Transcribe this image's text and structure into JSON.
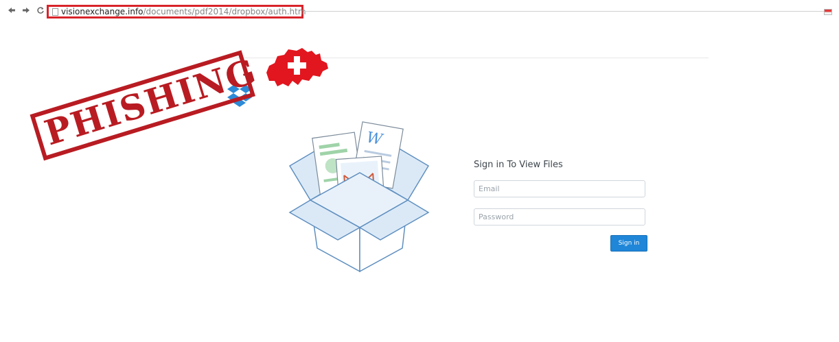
{
  "browser": {
    "back_icon": "back-arrow-icon",
    "forward_icon": "forward-arrow-icon",
    "reload_icon": "reload-icon",
    "back_glyph": "◆",
    "forward_glyph": "◆",
    "reload_glyph": "↺",
    "url_domain": "visionexchange.info",
    "url_path": "/documents/pdf2014/dropbox/auth.htm"
  },
  "stamp": {
    "text": "PHISHING",
    "color": "#b81c22"
  },
  "signin": {
    "heading": "Sign in To View Files",
    "email_placeholder": "Email",
    "password_placeholder": "Password",
    "button_label": "Sign in",
    "button_color": "#1f86d8"
  },
  "colors": {
    "highlight": "#d8232a",
    "dropbox_blue": "#2d8ad6",
    "swiss_red": "#e2161e"
  }
}
